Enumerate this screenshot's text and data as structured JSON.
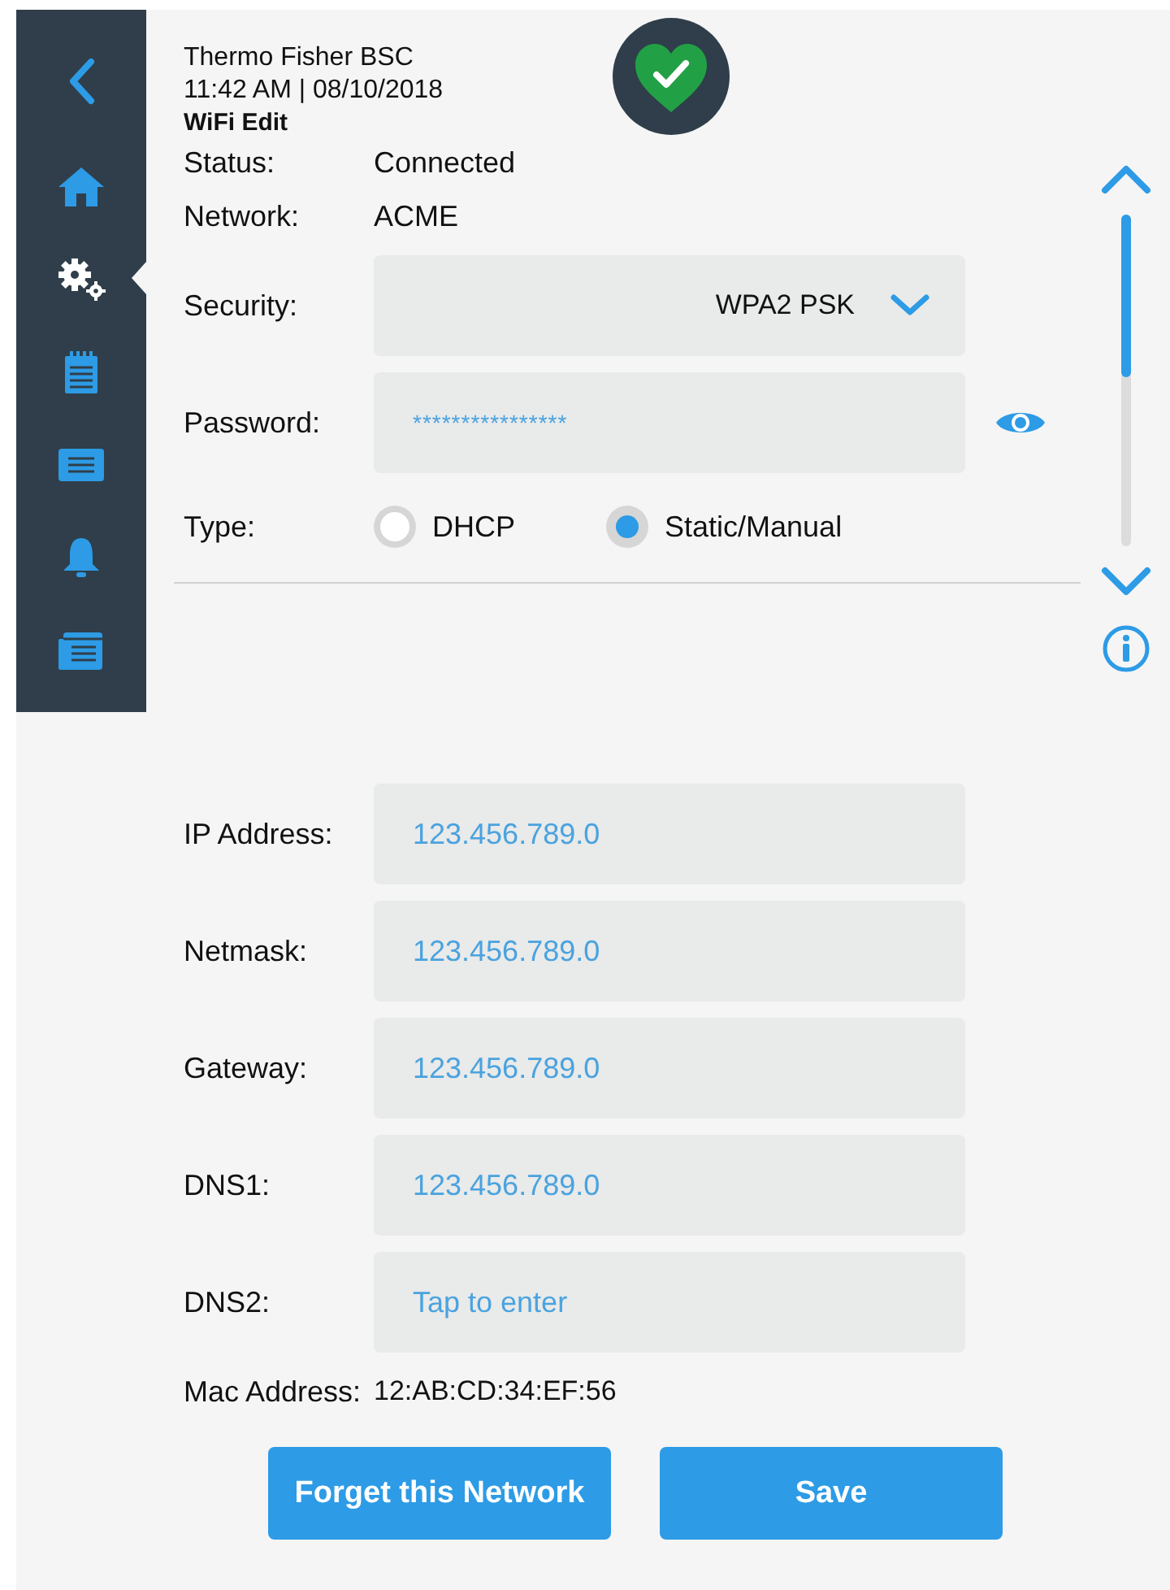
{
  "header": {
    "device": "Thermo Fisher BSC",
    "datetime": "11:42 AM | 08/10/2018",
    "screen_title": "WiFi Edit"
  },
  "sidebar": {
    "items": [
      {
        "selected": false
      },
      {
        "selected": true
      },
      {
        "selected": false
      },
      {
        "selected": false
      },
      {
        "selected": false
      },
      {
        "selected": false
      }
    ]
  },
  "info": [
    {
      "label": "Status:",
      "value": "Connected"
    },
    {
      "label": "Network:",
      "value": "ACME"
    }
  ],
  "security": {
    "label": "Security:",
    "value": "WPA2 PSK"
  },
  "password": {
    "label": "Password:",
    "value": "****************"
  },
  "type": {
    "label": "Type:",
    "options": [
      {
        "label": "DHCP",
        "selected": false
      },
      {
        "label": "Static/Manual",
        "selected": true
      }
    ]
  },
  "fields": [
    {
      "label": "IP Address:",
      "value": "123.456.789.0"
    },
    {
      "label": "Netmask:",
      "value": "123.456.789.0"
    },
    {
      "label": "Gateway:",
      "value": "123.456.789.0"
    },
    {
      "label": "DNS1:",
      "value": "123.456.789.0"
    },
    {
      "label": "DNS2:",
      "placeholder": "Tap to enter"
    }
  ],
  "mac": {
    "label": "Mac Address:",
    "value": "12:AB:CD:34:EF:56"
  },
  "buttons": [
    {
      "label": "Forget this Network"
    },
    {
      "label": "Save"
    }
  ]
}
